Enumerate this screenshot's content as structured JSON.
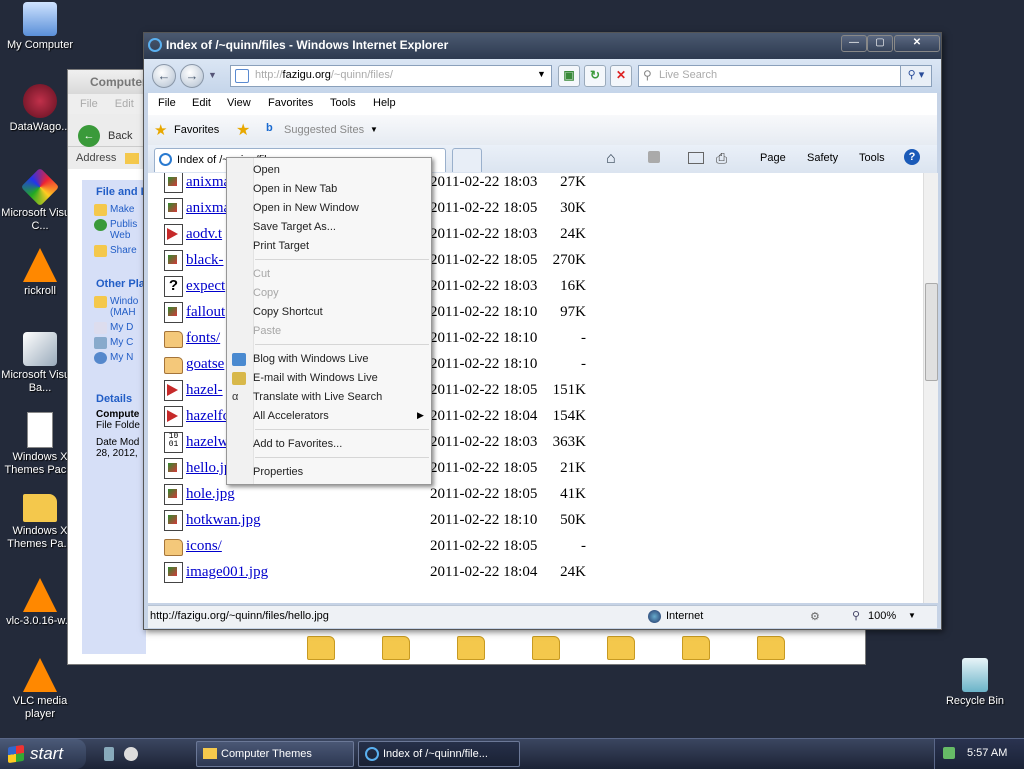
{
  "desktop": {
    "icons": [
      {
        "label": "My Computer"
      },
      {
        "label": "DataWago..."
      },
      {
        "label": "Microsoft Visual C..."
      },
      {
        "label": "rickroll"
      },
      {
        "label": "Microsoft Visual Ba..."
      },
      {
        "label": "Windows X Themes Pac..."
      },
      {
        "label": "Windows X Themes Pa..."
      },
      {
        "label": "vlc-3.0.16-w..."
      },
      {
        "label": "VLC media player"
      },
      {
        "label": "Recycle Bin"
      }
    ]
  },
  "explorer": {
    "title": "Computer",
    "menu": [
      "File",
      "Edit"
    ],
    "back_label": "Back",
    "address_label": "Address",
    "sections": {
      "file_tasks": "File and I",
      "other_places": "Other Pla",
      "details": "Details"
    },
    "tasks": [
      "Make",
      "Publis Web",
      "Share"
    ],
    "places": [
      "Windo (MAH",
      "My D",
      "My C",
      "My N"
    ],
    "details_name": "Compute",
    "details_type": "File Folde",
    "details_date": "Date Mod 28, 2012,"
  },
  "ie": {
    "title": "Index of /~quinn/files - Windows Internet Explorer",
    "address_prefix": "http://",
    "address_host": "fazigu.org",
    "address_path": "/~quinn/files/",
    "search_placeholder": "Live Search",
    "menu": [
      "File",
      "Edit",
      "View",
      "Favorites",
      "Tools",
      "Help"
    ],
    "favorites_label": "Favorites",
    "suggested_label": "Suggested Sites",
    "tab_label": "Index of /~quinn/files",
    "commands": [
      "Page",
      "Safety",
      "Tools"
    ],
    "status_url": "http://fazigu.org/~quinn/files/hello.jpg",
    "zone": "Internet",
    "zoom": "100%"
  },
  "files": [
    {
      "name": "anixma",
      "date": "2011-02-22 18:03",
      "size": "27K",
      "type": "img"
    },
    {
      "name": "anixma",
      "date": "2011-02-22 18:05",
      "size": "30K",
      "type": "img"
    },
    {
      "name": "aodv.t",
      "date": "2011-02-22 18:03",
      "size": "24K",
      "type": "pdf"
    },
    {
      "name": "black-",
      "date": "2011-02-22 18:05",
      "size": "270K",
      "type": "img"
    },
    {
      "name": "expect",
      "date": "2011-02-22 18:03",
      "size": "16K",
      "type": "unk"
    },
    {
      "name": "fallout",
      "date": "2011-02-22 18:10",
      "size": "97K",
      "type": "img"
    },
    {
      "name": "fonts/",
      "date": "2011-02-22 18:10",
      "size": "-",
      "type": "folder"
    },
    {
      "name": "goatse",
      "date": "2011-02-22 18:10",
      "size": "-",
      "type": "folder"
    },
    {
      "name": "hazel-",
      "date": "2011-02-22 18:05",
      "size": "151K",
      "type": "pdf"
    },
    {
      "name": "hazelfc",
      "date": "2011-02-22 18:04",
      "size": "154K",
      "type": "pdf"
    },
    {
      "name": "hazelw",
      "date": "2011-02-22 18:03",
      "size": "363K",
      "type": "bin"
    },
    {
      "name": "hello.jpg",
      "date": "2011-02-22 18:05",
      "size": "21K",
      "type": "img"
    },
    {
      "name": "hole.jpg",
      "date": "2011-02-22 18:05",
      "size": "41K",
      "type": "img"
    },
    {
      "name": "hotkwan.jpg",
      "date": "2011-02-22 18:10",
      "size": "50K",
      "type": "img"
    },
    {
      "name": "icons/",
      "date": "2011-02-22 18:05",
      "size": "-",
      "type": "folder"
    },
    {
      "name": "image001.jpg",
      "date": "2011-02-22 18:04",
      "size": "24K",
      "type": "img"
    }
  ],
  "context_menu": {
    "items": [
      {
        "label": "Open",
        "disabled": false
      },
      {
        "label": "Open in New Tab",
        "disabled": false
      },
      {
        "label": "Open in New Window",
        "disabled": false
      },
      {
        "label": "Save Target As...",
        "disabled": false
      },
      {
        "label": "Print Target",
        "disabled": false
      },
      {
        "label": "Cut",
        "disabled": true
      },
      {
        "label": "Copy",
        "disabled": true
      },
      {
        "label": "Copy Shortcut",
        "disabled": false
      },
      {
        "label": "Paste",
        "disabled": true
      },
      {
        "label": "Blog with Windows Live",
        "disabled": false
      },
      {
        "label": "E-mail with Windows Live",
        "disabled": false
      },
      {
        "label": "Translate with Live Search",
        "disabled": false
      },
      {
        "label": "All Accelerators",
        "disabled": false
      },
      {
        "label": "Add to Favorites...",
        "disabled": false
      },
      {
        "label": "Properties",
        "disabled": false
      }
    ]
  },
  "taskbar": {
    "start_label": "start",
    "tasks": [
      {
        "label": "Computer Themes"
      },
      {
        "label": "Index of /~quinn/file..."
      }
    ],
    "clock": "5:57 AM"
  },
  "colors": {
    "desktop": "#232a3a",
    "link": "#0000cc",
    "titlebar": "#2d3a50"
  }
}
